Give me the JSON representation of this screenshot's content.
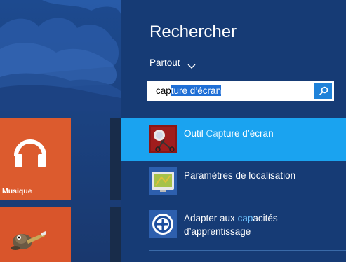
{
  "start": {
    "tiles": [
      {
        "label": "Musique",
        "icon": "headphones-icon"
      },
      {
        "label": "",
        "icon": "gimp-icon"
      }
    ]
  },
  "search": {
    "title": "Rechercher",
    "scope": "Partout",
    "query_plain": "cap",
    "query_selected": "ture d’écran"
  },
  "results": [
    {
      "prefix": "Outil ",
      "match": "Cap",
      "suffix": "ture d’écran",
      "icon": "snipping-tool-icon",
      "selected": true
    },
    {
      "line1": "Paramètres de localisation",
      "icon": "location-settings-icon"
    },
    {
      "line1_prefix": "Adapter aux ",
      "line1_match": "cap",
      "line1_suffix": "acités",
      "line2": "d’apprentissage",
      "icon": "ease-of-access-icon"
    }
  ],
  "colors": {
    "charm_bg": "#163b75",
    "selected_bg": "#1aa3f0",
    "tile_orange": "#dc5b2e",
    "search_button": "#1f82d9"
  }
}
